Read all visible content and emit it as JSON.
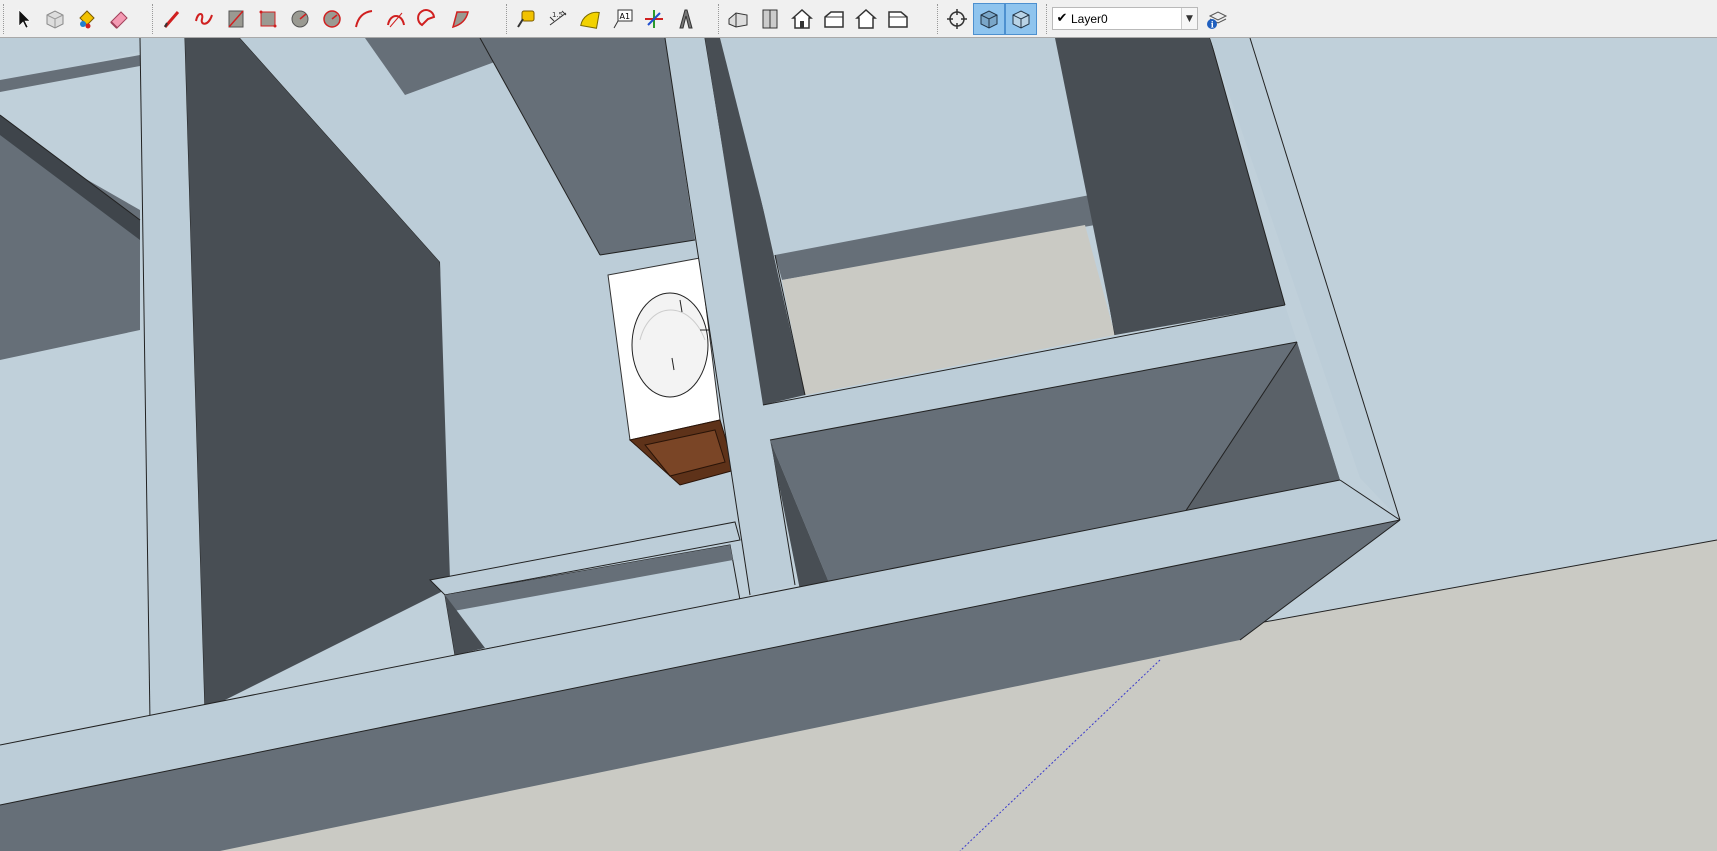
{
  "app": "SketchUp",
  "toolbar": {
    "groups": [
      {
        "name": "principal",
        "tools": [
          "select",
          "make-component",
          "paint-bucket",
          "eraser"
        ]
      },
      {
        "name": "drawing",
        "tools": [
          "line",
          "freehand",
          "rectangle",
          "rotated-rectangle",
          "circle",
          "polygon",
          "arc",
          "two-point-arc",
          "pie",
          "three-point-arc"
        ]
      },
      {
        "name": "construction",
        "tools": [
          "tape-measure",
          "dimension",
          "protractor",
          "text",
          "axes",
          "3d-text"
        ]
      },
      {
        "name": "views",
        "tools": [
          "iso-view",
          "top-view",
          "front-view",
          "right-view",
          "back-view",
          "left-view"
        ]
      },
      {
        "name": "style",
        "tools": [
          "xray",
          "back-edges",
          "wireframe"
        ],
        "active": [
          "back-edges",
          "wireframe"
        ]
      }
    ],
    "layer": {
      "checked": "✔",
      "current": "Layer0",
      "arrow": "▼"
    }
  },
  "colors": {
    "sky": "#c0d0da",
    "ground": "#cacac4",
    "wall_top": "#bccdd8",
    "wall_face": "#666f78",
    "shadow": "#484e54",
    "pedestal": "#ffffff",
    "cabinet": "#5e3219",
    "active_button": "#8fc4ee"
  }
}
